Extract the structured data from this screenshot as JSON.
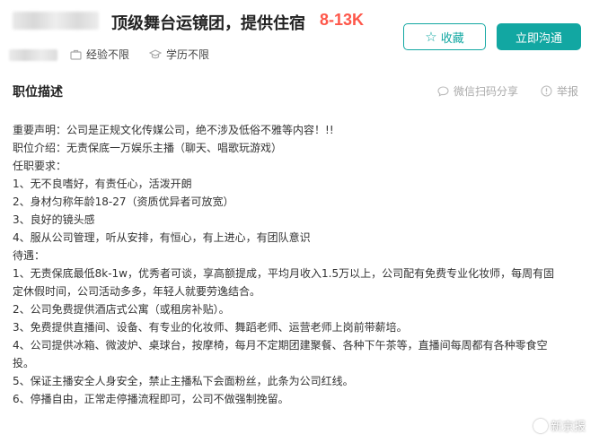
{
  "header": {
    "job_title": "顶级舞台运镜团，提供住宿",
    "salary": "8-13K",
    "favorite_label": "收藏",
    "chat_label": "立即沟通",
    "experience": "经验不限",
    "education": "学历不限"
  },
  "section": {
    "title": "职位描述",
    "wechat_share": "微信扫码分享",
    "report": "举报"
  },
  "description": {
    "lines": [
      "重要声明：公司是正规文化传媒公司，绝不涉及低俗不雅等内容！!!",
      "职位介绍：无责保底一万娱乐主播（聊天、唱歌玩游戏）",
      "任职要求：",
      "1、无不良嗜好，有责任心，活泼开朗",
      "2、身材匀称年龄18-27（资质优异者可放宽）",
      "3、良好的镜头感",
      "4、服从公司管理，听从安排，有恒心，有上进心，有团队意识",
      "待遇：",
      "1、无责保底最低8k-1w，优秀者可谈，享高额提成，平均月收入1.5万以上，公司配有免费专业化妆师，每周有固",
      "定休假时间，公司活动多多，年轻人就要劳逸结合。",
      "2、公司免费提供酒店式公寓（或租房补贴）。",
      "3、免费提供直播间、设备、有专业的化妆师、舞蹈老师、运营老师上岗前带薪培。",
      "4、公司提供冰箱、微波炉、桌球台，按摩椅，每月不定期团建聚餐、各种下午茶等，直播间每周都有各种零食空",
      "投。",
      "5、保证主播安全人身安全，禁止主播私下会面粉丝，此条为公司红线。",
      "6、停播自由，正常走停播流程即可，公司不做强制挽留。"
    ]
  },
  "watermark": {
    "text": "新京报"
  },
  "colors": {
    "accent": "#12a7a2",
    "salary": "#fe574a"
  }
}
